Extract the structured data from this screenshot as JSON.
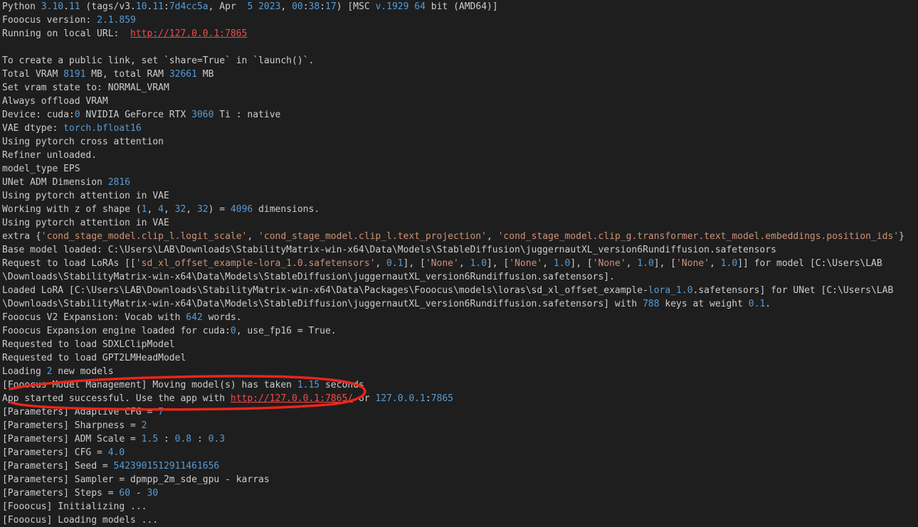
{
  "colors": {
    "background": "#1e1e1e",
    "text": "#cccccc",
    "number": "#569cd6",
    "string": "#ce9178",
    "url": "#f14c4c",
    "annotation": "#e8261c"
  },
  "terminal": {
    "lines": [
      [
        [
          "t",
          "Python "
        ],
        [
          "n",
          "3.10"
        ],
        [
          "t",
          "."
        ],
        [
          "n",
          "11"
        ],
        [
          "t",
          " (tags/v3."
        ],
        [
          "n",
          "10"
        ],
        [
          "t",
          "."
        ],
        [
          "n",
          "11"
        ],
        [
          "t",
          ":"
        ],
        [
          "n",
          "7d4cc5a"
        ],
        [
          "t",
          ", Apr  "
        ],
        [
          "n",
          "5"
        ],
        [
          "t",
          " "
        ],
        [
          "n",
          "2023"
        ],
        [
          "t",
          ", "
        ],
        [
          "n",
          "00"
        ],
        [
          "t",
          ":"
        ],
        [
          "n",
          "38"
        ],
        [
          "t",
          ":"
        ],
        [
          "n",
          "17"
        ],
        [
          "t",
          ") [MSC "
        ],
        [
          "n",
          "v.1929"
        ],
        [
          "t",
          " "
        ],
        [
          "n",
          "64"
        ],
        [
          "t",
          " bit (AMD64)]"
        ]
      ],
      [
        [
          "t",
          "Fooocus version: "
        ],
        [
          "n",
          "2.1.859"
        ]
      ],
      [
        [
          "t",
          "Running on local URL:  "
        ],
        [
          "u",
          "http://127.0.0.1:7865"
        ]
      ],
      [
        [
          "t",
          ""
        ]
      ],
      [
        [
          "t",
          "To create a public link, set `share=True` in `launch()`."
        ]
      ],
      [
        [
          "t",
          "Total VRAM "
        ],
        [
          "n",
          "8191"
        ],
        [
          "t",
          " MB, total RAM "
        ],
        [
          "n",
          "32661"
        ],
        [
          "t",
          " MB"
        ]
      ],
      [
        [
          "t",
          "Set vram state to: NORMAL_VRAM"
        ]
      ],
      [
        [
          "t",
          "Always offload VRAM"
        ]
      ],
      [
        [
          "t",
          "Device: cuda:"
        ],
        [
          "n",
          "0"
        ],
        [
          "t",
          " NVIDIA GeForce RTX "
        ],
        [
          "n",
          "3060"
        ],
        [
          "t",
          " Ti : native"
        ]
      ],
      [
        [
          "t",
          "VAE dtype: "
        ],
        [
          "n",
          "torch.bfloat16"
        ]
      ],
      [
        [
          "t",
          "Using pytorch cross attention"
        ]
      ],
      [
        [
          "t",
          "Refiner unloaded."
        ]
      ],
      [
        [
          "t",
          "model_type EPS"
        ]
      ],
      [
        [
          "t",
          "UNet ADM Dimension "
        ],
        [
          "n",
          "2816"
        ]
      ],
      [
        [
          "t",
          "Using pytorch attention in VAE"
        ]
      ],
      [
        [
          "t",
          "Working with z of shape ("
        ],
        [
          "n",
          "1"
        ],
        [
          "t",
          ", "
        ],
        [
          "n",
          "4"
        ],
        [
          "t",
          ", "
        ],
        [
          "n",
          "32"
        ],
        [
          "t",
          ", "
        ],
        [
          "n",
          "32"
        ],
        [
          "t",
          ") = "
        ],
        [
          "n",
          "4096"
        ],
        [
          "t",
          " dimensions."
        ]
      ],
      [
        [
          "t",
          "Using pytorch attention in VAE"
        ]
      ],
      [
        [
          "t",
          "extra {"
        ],
        [
          "s",
          "'cond_stage_model.clip_l.logit_scale'"
        ],
        [
          "t",
          ", "
        ],
        [
          "s",
          "'cond_stage_model.clip_l.text_projection'"
        ],
        [
          "t",
          ", "
        ],
        [
          "s",
          "'cond_stage_model.clip_g.transformer.text_model.embeddings.position_ids'"
        ],
        [
          "t",
          "}"
        ]
      ],
      [
        [
          "t",
          "Base model loaded: C:\\Users\\LAB\\Downloads\\StabilityMatrix-win-x64\\Data\\Models\\StableDiffusion\\juggernautXL_version6Rundiffusion.safetensors"
        ]
      ],
      [
        [
          "t",
          "Request to load LoRAs [["
        ],
        [
          "s",
          "'sd_xl_offset_example-lora_1.0.safetensors'"
        ],
        [
          "t",
          ", "
        ],
        [
          "n",
          "0.1"
        ],
        [
          "t",
          "], ["
        ],
        [
          "s",
          "'None'"
        ],
        [
          "t",
          ", "
        ],
        [
          "n",
          "1.0"
        ],
        [
          "t",
          "], ["
        ],
        [
          "s",
          "'None'"
        ],
        [
          "t",
          ", "
        ],
        [
          "n",
          "1.0"
        ],
        [
          "t",
          "], ["
        ],
        [
          "s",
          "'None'"
        ],
        [
          "t",
          ", "
        ],
        [
          "n",
          "1.0"
        ],
        [
          "t",
          "], ["
        ],
        [
          "s",
          "'None'"
        ],
        [
          "t",
          ", "
        ],
        [
          "n",
          "1.0"
        ],
        [
          "t",
          "]] for model [C:\\Users\\LAB"
        ]
      ],
      [
        [
          "t",
          "\\Downloads\\StabilityMatrix-win-x64\\Data\\Models\\StableDiffusion\\juggernautXL_version6Rundiffusion.safetensors]."
        ]
      ],
      [
        [
          "t",
          "Loaded LoRA [C:\\Users\\LAB\\Downloads\\StabilityMatrix-win-x64\\Data\\Packages\\Fooocus\\models\\loras\\sd_xl_offset_example-"
        ],
        [
          "n",
          "lora_1.0"
        ],
        [
          "t",
          ".safetensors] for UNet [C:\\Users\\LAB"
        ]
      ],
      [
        [
          "t",
          "\\Downloads\\StabilityMatrix-win-x64\\Data\\Models\\StableDiffusion\\juggernautXL_version6Rundiffusion.safetensors] with "
        ],
        [
          "n",
          "788"
        ],
        [
          "t",
          " keys at weight "
        ],
        [
          "n",
          "0.1"
        ],
        [
          "t",
          "."
        ]
      ],
      [
        [
          "t",
          "Fooocus V2 Expansion: Vocab with "
        ],
        [
          "n",
          "642"
        ],
        [
          "t",
          " words."
        ]
      ],
      [
        [
          "t",
          "Fooocus Expansion engine loaded for cuda:"
        ],
        [
          "n",
          "0"
        ],
        [
          "t",
          ", use_fp16 = True."
        ]
      ],
      [
        [
          "t",
          "Requested to load SDXLClipModel"
        ]
      ],
      [
        [
          "t",
          "Requested to load GPT2LMHeadModel"
        ]
      ],
      [
        [
          "t",
          "Loading "
        ],
        [
          "n",
          "2"
        ],
        [
          "t",
          " new models"
        ]
      ],
      [
        [
          "t",
          "[Fooocus Model Management] Moving model(s) has taken "
        ],
        [
          "n",
          "1.15"
        ],
        [
          "t",
          " seconds"
        ]
      ],
      [
        [
          "t",
          "App started successful. Use the app with "
        ],
        [
          "u",
          "http://127.0.0.1:7865/"
        ],
        [
          "t",
          " or "
        ],
        [
          "n",
          "127.0.0.1"
        ],
        [
          "t",
          ":"
        ],
        [
          "n",
          "7865"
        ]
      ],
      [
        [
          "t",
          "[Parameters] Adaptive CFG = "
        ],
        [
          "n",
          "7"
        ]
      ],
      [
        [
          "t",
          "[Parameters] Sharpness = "
        ],
        [
          "n",
          "2"
        ]
      ],
      [
        [
          "t",
          "[Parameters] ADM Scale = "
        ],
        [
          "n",
          "1.5"
        ],
        [
          "t",
          " : "
        ],
        [
          "n",
          "0.8"
        ],
        [
          "t",
          " : "
        ],
        [
          "n",
          "0.3"
        ]
      ],
      [
        [
          "t",
          "[Parameters] CFG = "
        ],
        [
          "n",
          "4.0"
        ]
      ],
      [
        [
          "t",
          "[Parameters] Seed = "
        ],
        [
          "n",
          "5423901512911461656"
        ]
      ],
      [
        [
          "t",
          "[Parameters] Sampler = dpmpp_2m_sde_gpu - karras"
        ]
      ],
      [
        [
          "t",
          "[Parameters] Steps = "
        ],
        [
          "n",
          "60"
        ],
        [
          "t",
          " - "
        ],
        [
          "n",
          "30"
        ]
      ],
      [
        [
          "t",
          "[Fooocus] Initializing ..."
        ]
      ],
      [
        [
          "t",
          "[Fooocus] Loading models ..."
        ]
      ]
    ]
  }
}
